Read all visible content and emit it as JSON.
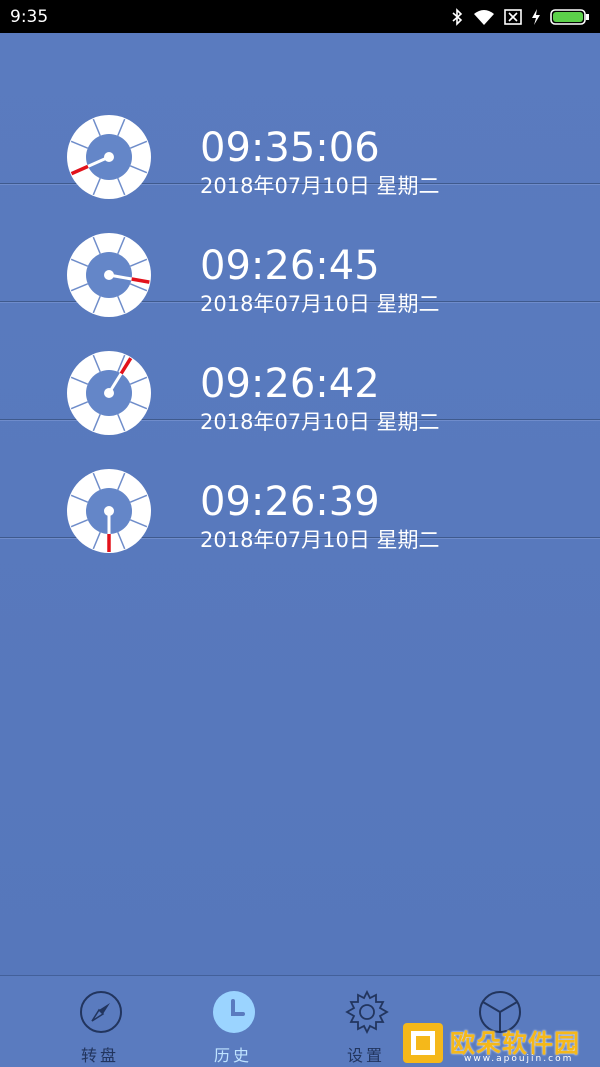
{
  "status_bar": {
    "time": "9:35",
    "icons": [
      "bluetooth-icon",
      "wifi-icon",
      "sim-off-icon",
      "charging-icon",
      "battery-icon"
    ],
    "battery_color": "#5cd04a"
  },
  "history": [
    {
      "time": "09:35:06",
      "date": "2018年07月10日 星期二",
      "pointer_angle": 246
    },
    {
      "time": "09:26:45",
      "date": "2018年07月10日 星期二",
      "pointer_angle": 100
    },
    {
      "time": "09:26:42",
      "date": "2018年07月10日 星期二",
      "pointer_angle": 32
    },
    {
      "time": "09:26:39",
      "date": "2018年07月10日 星期二",
      "pointer_angle": 180
    }
  ],
  "tabs": [
    {
      "label": "转盘",
      "icon": "compass-icon",
      "active": false
    },
    {
      "label": "历史",
      "icon": "clock-icon",
      "active": true
    },
    {
      "label": "设置",
      "icon": "gear-icon",
      "active": false
    },
    {
      "label": "",
      "icon": "pie-icon",
      "active": false
    }
  ],
  "watermark": {
    "text": "欧朵软件园",
    "sub": "www.apoujin.com"
  },
  "colors": {
    "background": "#5a7bbf",
    "pointer_red": "#e3121b",
    "dial_center": "#6486c8",
    "active_tab": "#9bd4ff"
  }
}
